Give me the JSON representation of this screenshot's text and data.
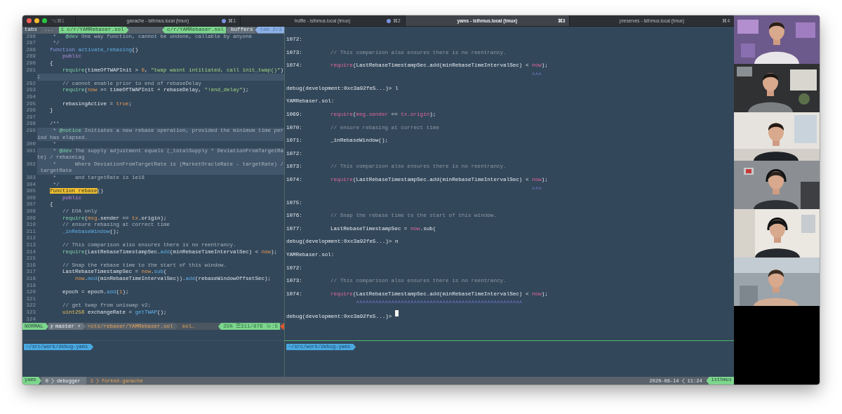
{
  "window": {
    "shortcut": "⌥⌘1",
    "tabs": [
      {
        "title": "ganache - isthmus.local (tmux)",
        "shortcut": "⌘1",
        "activity": true,
        "selected": false
      },
      {
        "title": "truffle - isthmus.local (tmux)",
        "shortcut": "⌘2",
        "activity": true,
        "selected": false
      },
      {
        "title": "yams - isthmus.local (tmux)",
        "shortcut": "⌘3",
        "activity": false,
        "selected": true
      },
      {
        "title": "preserves - isthmus.local (tmux)",
        "shortcut": "⌘4",
        "activity": false,
        "selected": false
      }
    ]
  },
  "editor": {
    "tabline": {
      "label": "tabs",
      "overflow": "...",
      "tabs": [
        {
          "number": "1",
          "name": "c/r/YAMRebaser.sol",
          "selected": true
        }
      ],
      "buffer": "c/r/YAMRebaser.sol",
      "section": "buffers",
      "tab_position": "tab 2/2"
    },
    "lines": [
      {
        "number": "286",
        "highlight": false,
        "code": [
          {
            "text": "     *   ",
            "kind": "comment"
          },
          {
            "text": "@dev",
            "kind": "tag"
          },
          {
            "text": " One way function, cannot be undone, callable by anyone",
            "kind": "comment"
          }
        ]
      },
      {
        "number": "287",
        "highlight": false,
        "code": [
          {
            "text": "     */",
            "kind": "comment"
          }
        ]
      },
      {
        "number": "288",
        "highlight": false,
        "code": [
          {
            "text": "    function ",
            "kind": "keyword"
          },
          {
            "text": "activate_rebasing",
            "kind": "function"
          },
          {
            "text": "()",
            "kind": "plain"
          }
        ]
      },
      {
        "number": "289",
        "highlight": false,
        "code": [
          {
            "text": "        public",
            "kind": "modifier"
          }
        ]
      },
      {
        "number": "290",
        "highlight": false,
        "code": [
          {
            "text": "    {",
            "kind": "plain"
          }
        ]
      },
      {
        "number": "291",
        "highlight": false,
        "code": [
          {
            "text": "        require",
            "kind": "call"
          },
          {
            "text": "(timeOfTWAPInit > ",
            "kind": "plain"
          },
          {
            "text": "0",
            "kind": "constant"
          },
          {
            "text": ", ",
            "kind": "plain"
          },
          {
            "text": "\"twap wasnt intitiated, call init_twap()\"",
            "kind": "string"
          },
          {
            "text": ")",
            "kind": "plain"
          }
        ]
      },
      {
        "highlight": true,
        "code": [
          {
            "text": ";",
            "kind": "plain"
          }
        ]
      },
      {
        "number": "292",
        "highlight": false,
        "code": [
          {
            "text": "        // cannot enable prior to end of rebaseDelay",
            "kind": "comment"
          }
        ]
      },
      {
        "number": "293",
        "highlight": false,
        "code": [
          {
            "text": "        require",
            "kind": "call"
          },
          {
            "text": "(",
            "kind": "plain"
          },
          {
            "text": "now",
            "kind": "constant"
          },
          {
            "text": " >= timeOfTWAPInit + rebaseDelay, ",
            "kind": "plain"
          },
          {
            "text": "\"!end_delay\"",
            "kind": "string"
          },
          {
            "text": ");",
            "kind": "plain"
          }
        ]
      },
      {
        "number": "294",
        "highlight": false
      },
      {
        "number": "295",
        "highlight": false,
        "code": [
          {
            "text": "        rebasingActive = ",
            "kind": "plain"
          },
          {
            "text": "true",
            "kind": "constant"
          },
          {
            "text": ";",
            "kind": "plain"
          }
        ]
      },
      {
        "number": "296",
        "highlight": false,
        "code": [
          {
            "text": "    }",
            "kind": "plain"
          }
        ]
      },
      {
        "number": "297",
        "highlight": false
      },
      {
        "number": "298",
        "highlight": false,
        "code": [
          {
            "text": "    /**",
            "kind": "comment"
          }
        ]
      },
      {
        "number": "299",
        "highlight": true,
        "code": [
          {
            "text": "     * ",
            "kind": "comment"
          },
          {
            "text": "@notice",
            "kind": "tag"
          },
          {
            "text": " Initiates a new rebase operation, provided the minimum time per",
            "kind": "comment"
          }
        ]
      },
      {
        "highlight": true,
        "code": [
          {
            "text": "iod has elapsed.",
            "kind": "comment"
          }
        ]
      },
      {
        "number": "300",
        "highlight": false,
        "code": [
          {
            "text": "     *",
            "kind": "comment"
          }
        ]
      },
      {
        "number": "301",
        "highlight": true,
        "code": [
          {
            "text": "     * ",
            "kind": "comment"
          },
          {
            "text": "@dev",
            "kind": "tag"
          },
          {
            "text": " The supply adjustment equals (_totalSupply * DeviationFromTargetRa",
            "kind": "comment"
          }
        ]
      },
      {
        "highlight": true,
        "code": [
          {
            "text": "te) / rebaseLag",
            "kind": "comment"
          }
        ]
      },
      {
        "number": "302",
        "highlight": true,
        "code": [
          {
            "text": "     *      Where DeviationFromTargetRate is (MarketOracleRate - targetRate) /",
            "kind": "comment"
          }
        ]
      },
      {
        "highlight": true,
        "code": [
          {
            "text": " targetRate",
            "kind": "comment"
          }
        ]
      },
      {
        "number": "303",
        "highlight": false,
        "code": [
          {
            "text": "     *      and targetRate is 1e18",
            "kind": "comment"
          }
        ]
      },
      {
        "number": "304",
        "highlight": false,
        "code": [
          {
            "text": "     */",
            "kind": "comment"
          }
        ]
      },
      {
        "number": "305",
        "highlight": false,
        "code": [
          {
            "text": "    function rebase",
            "kind": "match"
          },
          {
            "text": "()",
            "kind": "plain"
          }
        ]
      },
      {
        "number": "306",
        "highlight": false,
        "code": [
          {
            "text": "        public",
            "kind": "modifier"
          }
        ]
      },
      {
        "number": "307",
        "highlight": false,
        "code": [
          {
            "text": "    {",
            "kind": "plain"
          }
        ]
      },
      {
        "number": "308",
        "highlight": false,
        "code": [
          {
            "text": "        // EOA only",
            "kind": "comment"
          }
        ]
      },
      {
        "number": "309",
        "highlight": false,
        "code": [
          {
            "text": "        require",
            "kind": "call"
          },
          {
            "text": "(",
            "kind": "plain"
          },
          {
            "text": "msg",
            "kind": "constant"
          },
          {
            "text": ".sender == ",
            "kind": "plain"
          },
          {
            "text": "tx",
            "kind": "constant"
          },
          {
            "text": ".origin);",
            "kind": "plain"
          }
        ]
      },
      {
        "number": "310",
        "highlight": false,
        "code": [
          {
            "text": "        // ensure rebasing at correct time",
            "kind": "comment"
          }
        ]
      },
      {
        "number": "311",
        "highlight": false,
        "code": [
          {
            "text": "        _inRebaseWindow",
            "kind": "function"
          },
          {
            "text": "();",
            "kind": "plain"
          }
        ]
      },
      {
        "number": "312",
        "highlight": false
      },
      {
        "number": "313",
        "highlight": false,
        "code": [
          {
            "text": "        // This comparison also ensures there is no reentrancy.",
            "kind": "comment"
          }
        ]
      },
      {
        "number": "314",
        "highlight": false,
        "code": [
          {
            "text": "        require",
            "kind": "call"
          },
          {
            "text": "(LastRebaseTimestampSec.",
            "kind": "plain"
          },
          {
            "text": "add",
            "kind": "function"
          },
          {
            "text": "(minRebaseTimeIntervalSec) < ",
            "kind": "plain"
          },
          {
            "text": "now",
            "kind": "constant"
          },
          {
            "text": ");",
            "kind": "plain"
          }
        ]
      },
      {
        "number": "315",
        "highlight": false
      },
      {
        "number": "316",
        "highlight": false,
        "code": [
          {
            "text": "        // Snap the rebase time to the start of this window.",
            "kind": "comment"
          }
        ]
      },
      {
        "number": "317",
        "highlight": false,
        "code": [
          {
            "text": "        LastRebaseTimestampSec = ",
            "kind": "plain"
          },
          {
            "text": "now",
            "kind": "constant"
          },
          {
            "text": ".",
            "kind": "plain"
          },
          {
            "text": "sub",
            "kind": "function"
          },
          {
            "text": "(",
            "kind": "plain"
          }
        ]
      },
      {
        "number": "318",
        "highlight": false,
        "code": [
          {
            "text": "            now",
            "kind": "constant"
          },
          {
            "text": ".",
            "kind": "plain"
          },
          {
            "text": "mod",
            "kind": "function"
          },
          {
            "text": "(minRebaseTimeIntervalSec)).",
            "kind": "plain"
          },
          {
            "text": "add",
            "kind": "function"
          },
          {
            "text": "(rebaseWindowOffsetSec);",
            "kind": "plain"
          }
        ]
      },
      {
        "number": "319",
        "highlight": false
      },
      {
        "number": "320",
        "highlight": false,
        "code": [
          {
            "text": "        epoch = epoch.",
            "kind": "plain"
          },
          {
            "text": "add",
            "kind": "function"
          },
          {
            "text": "(",
            "kind": "plain"
          },
          {
            "text": "1",
            "kind": "constant"
          },
          {
            "text": ");",
            "kind": "plain"
          }
        ]
      },
      {
        "number": "321",
        "highlight": false
      },
      {
        "number": "322",
        "highlight": false,
        "code": [
          {
            "text": "        // get twap from uniswap v2;",
            "kind": "comment"
          }
        ]
      },
      {
        "number": "323",
        "highlight": false,
        "code": [
          {
            "text": "        uint256",
            "kind": "type"
          },
          {
            "text": " exchangeRate = ",
            "kind": "plain"
          },
          {
            "text": "getTWAP",
            "kind": "function"
          },
          {
            "text": "();",
            "kind": "plain"
          }
        ]
      },
      {
        "number": "324",
        "highlight": false
      }
    ],
    "statusline": {
      "mode": "NORMAL",
      "branch": "master",
      "modified": "⚡",
      "file": "<cts/rebaser/YAMRebaser.sol",
      "filetype": "sol…",
      "percent": "35%",
      "position": "☰311/876",
      "column": "㏑:5",
      "warning": true
    }
  },
  "debugger": {
    "rows": [
      {
        "kind": "source",
        "number": "1072:"
      },
      {
        "kind": "source",
        "number": "1073:",
        "code": [
          {
            "text": "// This comparison also ensures there is no reentrancy.",
            "kind": "comment"
          }
        ]
      },
      {
        "kind": "source",
        "number": "1074:",
        "code": [
          {
            "text": "require",
            "kind": "keyword"
          },
          {
            "text": "(LastRebaseTimestampSec.add(minRebaseTimeIntervalSec) < ",
            "kind": "plain"
          },
          {
            "text": "now",
            "kind": "keyword"
          },
          {
            "text": ");",
            "kind": "plain"
          }
        ]
      },
      {
        "kind": "marker",
        "text": "                                                               ^^^"
      },
      {
        "kind": "prompt",
        "text": "debug(development:0xc3a92fe5...)> l",
        "cursor": false
      },
      {
        "kind": "file",
        "text": "YAMRebaser.sol:"
      },
      {
        "kind": "source",
        "number": "1069:",
        "code": [
          {
            "text": "require",
            "kind": "keyword"
          },
          {
            "text": "(",
            "kind": "plain"
          },
          {
            "text": "msg.sender",
            "kind": "keyword"
          },
          {
            "text": " == ",
            "kind": "plain"
          },
          {
            "text": "tx.origin",
            "kind": "keyword"
          },
          {
            "text": ");",
            "kind": "plain"
          }
        ]
      },
      {
        "kind": "source",
        "number": "1070:",
        "code": [
          {
            "text": "// ensure rebasing at correct time",
            "kind": "comment"
          }
        ]
      },
      {
        "kind": "source",
        "number": "1071:",
        "code": [
          {
            "text": "_inRebaseWindow();",
            "kind": "plain"
          }
        ]
      },
      {
        "kind": "source",
        "number": "1072:"
      },
      {
        "kind": "source",
        "number": "1073:",
        "code": [
          {
            "text": "// This comparison also ensures there is no reentrancy.",
            "kind": "comment"
          }
        ]
      },
      {
        "kind": "source",
        "number": "1074:",
        "code": [
          {
            "text": "require",
            "kind": "keyword"
          },
          {
            "text": "(LastRebaseTimestampSec.add(minRebaseTimeIntervalSec) < ",
            "kind": "plain"
          },
          {
            "text": "now",
            "kind": "keyword"
          },
          {
            "text": ");",
            "kind": "plain"
          }
        ]
      },
      {
        "kind": "marker",
        "text": "                                                               ^^^"
      },
      {
        "kind": "source",
        "number": "1075:"
      },
      {
        "kind": "source",
        "number": "1076:",
        "code": [
          {
            "text": "// Snap the rebase time to the start of this window.",
            "kind": "comment"
          }
        ]
      },
      {
        "kind": "source",
        "number": "1077:",
        "code": [
          {
            "text": "LastRebaseTimestampSec = ",
            "kind": "plain"
          },
          {
            "text": "now",
            "kind": "keyword"
          },
          {
            "text": ".sub(",
            "kind": "plain"
          }
        ]
      },
      {
        "kind": "prompt",
        "text": "debug(development:0xc3a92fe5...)> n",
        "cursor": false
      },
      {
        "kind": "file",
        "text": "YAMRebaser.sol:"
      },
      {
        "kind": "source",
        "number": "1072:"
      },
      {
        "kind": "source",
        "number": "1073:",
        "code": [
          {
            "text": "// This comparison also ensures there is no reentrancy.",
            "kind": "comment"
          }
        ]
      },
      {
        "kind": "source",
        "number": "1074:",
        "code": [
          {
            "text": "require",
            "kind": "keyword"
          },
          {
            "text": "(LastRebaseTimestampSec.add(minRebaseTimeIntervalSec) < ",
            "kind": "plain"
          },
          {
            "text": "now",
            "kind": "keyword"
          },
          {
            "text": ");",
            "kind": "plain"
          }
        ]
      },
      {
        "kind": "marker",
        "text": "        ^^^^^^^^^^^^^^^^^^^^^^^^^^^^^^^^^^^^^^^^^^^^^^^^^^^^"
      },
      {
        "kind": "prompt",
        "text": "debug(development:0xc3a92fe5...)> ",
        "cursor": true
      }
    ]
  },
  "shell_prompts": [
    "~/src/work/debug-yams",
    "~/src/work/debug-yams"
  ],
  "tmux_status": {
    "session": "yams",
    "windows": [
      {
        "index": "0",
        "name": "debugger",
        "selected": true
      },
      {
        "index": "1",
        "name": "forked-ganache",
        "selected": false
      }
    ],
    "date": "2020-08-14",
    "time": "11:24",
    "host": "isthmus"
  },
  "video_call": {
    "tiles": [
      {
        "kind": "picture"
      },
      {
        "kind": "picture"
      },
      {
        "kind": "picture"
      },
      {
        "kind": "picture"
      },
      {
        "kind": "picture"
      },
      {
        "kind": "picture"
      }
    ]
  }
}
